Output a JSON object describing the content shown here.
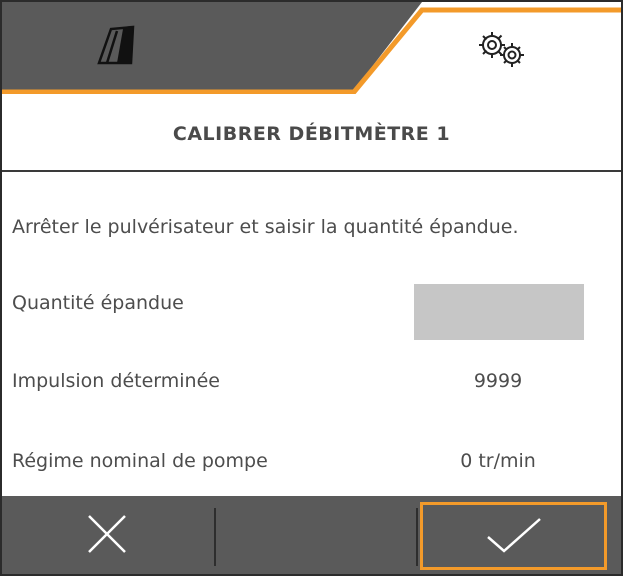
{
  "header": {
    "tabs": [
      {
        "icon": "field-icon",
        "active": false
      },
      {
        "icon": "gears-icon",
        "active": true
      }
    ],
    "colors": {
      "inactive_tab": "#5a5a5a",
      "active_tab": "#ffffff",
      "accent": "#f39a2a"
    }
  },
  "title": "CALIBRER DÉBITMÈTRE 1",
  "instruction": "Arrêter le pulvérisateur et saisir la quantité épandue.",
  "fields": {
    "quantity": {
      "label": "Quantité épandue",
      "value": ""
    },
    "impulse": {
      "label": "Impulsion déterminée",
      "value": "9999"
    },
    "pump_speed": {
      "label": "Régime nominal de pompe",
      "value": "0 tr/min"
    }
  },
  "bottom_bar": {
    "cancel_icon": "close-icon",
    "confirm_icon": "checkmark-icon"
  }
}
